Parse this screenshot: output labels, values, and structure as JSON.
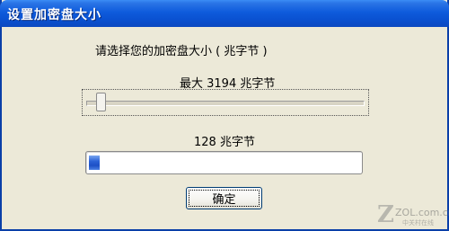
{
  "window": {
    "title": "设置加密盘大小"
  },
  "dialog": {
    "prompt": "请选择您的加密盘大小 ( 兆字节 )",
    "max_label": "最大 3194 兆字节",
    "slider": {
      "value_mb": 128,
      "max_mb": 3194
    },
    "value_label": "128 兆字节",
    "progress_fraction": 0.04,
    "ok_label": "确定"
  },
  "watermark": {
    "logo_letter": "Z",
    "site": "ZOL.com.cn",
    "subtitle": "中关村在线"
  },
  "colors": {
    "titlebar": "#0a52d2",
    "dialog_bg": "#ece9d8",
    "progress_fill": "#2b62d6"
  }
}
